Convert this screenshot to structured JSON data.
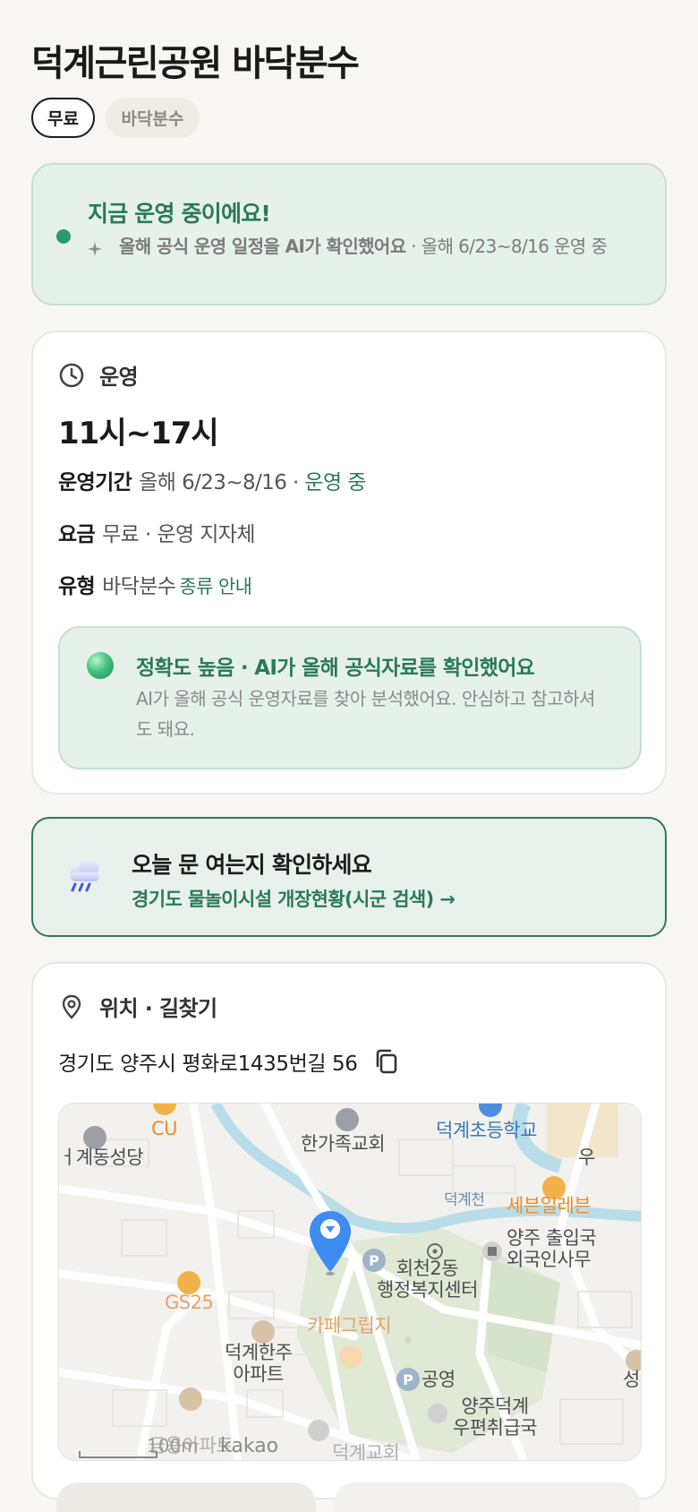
{
  "place": {
    "title": "덕계근린공원 바닥분수",
    "chips": {
      "fee": "무료",
      "type": "바닥분수"
    }
  },
  "status": {
    "title": "지금 운영 중이에요!",
    "source_bold": "올해 공식 운영 일정을 AI가 확인했어요",
    "source_rest": " · 올해 6/23~8/16 운영 중"
  },
  "operation": {
    "section_label": "운영",
    "hours": "11시~17시",
    "period": {
      "key": "운영기간",
      "value": "올해 6/23~8/16 · ",
      "status": "운영 중"
    },
    "fee": {
      "key": "요금",
      "value": "무료 · 운영 지자체"
    },
    "type": {
      "key": "유형",
      "value": "바닥분수",
      "link": "종류 안내"
    },
    "accuracy": {
      "title": "정확도 높음 · AI가 올해 공식자료를 확인했어요",
      "desc": "AI가 올해 공식 운영자료를 찾아 분석했어요. 안심하고 참고하셔도 돼요."
    }
  },
  "notice": {
    "title": "오늘 문 여는지 확인하세요",
    "link": "경기도 물놀이시설 개장현황(시군 검색) →"
  },
  "location": {
    "section_label": "위치 · 길찾기",
    "address": "경기도 양주시 평화로1435번길 56",
    "map": {
      "labels": {
        "cu": "CU",
        "church_family": "한가족교회",
        "school": "덕계초등학교",
        "cathedral": "ㅓ계동성당",
        "stream": "덕계천",
        "seven": "세븐일레븐",
        "immigration": "양주 출입국\n외국인사무",
        "community": "회천2동\n행정복지센터",
        "gs25": "GS25",
        "cafe": "카페그립지",
        "apt": "덕계한주\n아파트",
        "parking": "공영",
        "post": "양주덕계\n우편취급국",
        "apt2": "금용아파트",
        "church2": "덕계교회",
        "edge_u": "우",
        "edge_seong": "성"
      },
      "scale": "100m",
      "brand": "kakao"
    }
  },
  "colors": {
    "accent": "#2a7a57",
    "status_bg": "#e6f1ea",
    "page_bg": "#f8f6f2"
  }
}
